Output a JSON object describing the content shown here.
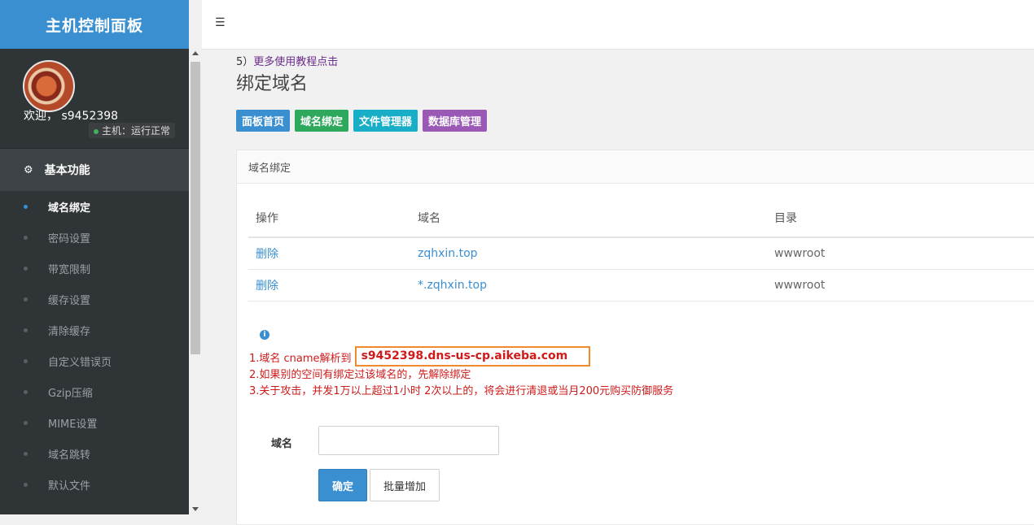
{
  "brand": {
    "title": "主机控制面板"
  },
  "user": {
    "welcome": "欢迎，  s9452398",
    "status": "主机：运行正常"
  },
  "sidebar": {
    "section_title": "基本功能",
    "items": [
      {
        "label": "域名绑定",
        "active": true
      },
      {
        "label": "密码设置"
      },
      {
        "label": "带宽限制"
      },
      {
        "label": "缓存设置"
      },
      {
        "label": "清除缓存"
      },
      {
        "label": "自定义错误页"
      },
      {
        "label": "Gzip压缩"
      },
      {
        "label": "MIME设置"
      },
      {
        "label": "域名跳转"
      },
      {
        "label": "默认文件"
      }
    ]
  },
  "main": {
    "tip_prefix": "5）",
    "tip_link": "更多使用教程点击",
    "page_title": "绑定域名",
    "tabs": [
      "面板首页",
      "域名绑定",
      "文件管理器",
      "数据库管理"
    ],
    "panel_title": "域名绑定",
    "table": {
      "headers": [
        "操作",
        "域名",
        "目录"
      ],
      "rows": [
        {
          "action": "删除",
          "domain": "zqhxin.top",
          "dir": "wwwroot"
        },
        {
          "action": "删除",
          "domain": "*.zqhxin.top",
          "dir": "wwwroot"
        }
      ]
    },
    "notes": {
      "line1_prefix": "1.域名 cname解析到",
      "cname": "s9452398.dns-us-cp.aikeba.com",
      "line2": "2.如果别的空间有绑定过该域名的，先解除绑定",
      "line3": "3.关于攻击，并发1万以上超过1小时 2次以上的，将会进行清退或当月200元购买防御服务"
    },
    "form": {
      "label": "域名",
      "value": "",
      "ok": "确定",
      "batch": "批量增加"
    }
  }
}
